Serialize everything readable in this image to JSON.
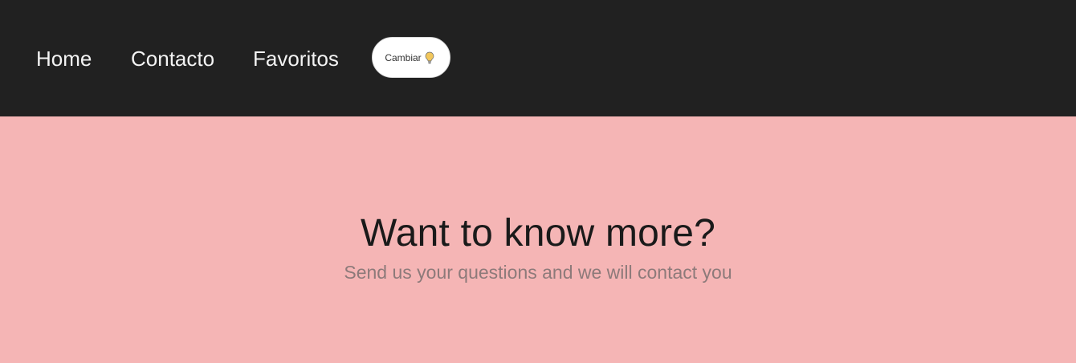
{
  "navbar": {
    "links": [
      {
        "label": "Home"
      },
      {
        "label": "Contacto"
      },
      {
        "label": "Favoritos"
      }
    ],
    "toggle_button": {
      "label": "Cambiar",
      "icon": "lightbulb-icon"
    }
  },
  "hero": {
    "title": "Want to know more?",
    "subtitle": "Send us your questions and we will contact you"
  },
  "colors": {
    "navbar_background": "#212121",
    "hero_background": "#f5b5b5",
    "nav_text": "#f3f3f3",
    "button_background": "#ffffff",
    "bulb_color": "#f2c75c"
  }
}
